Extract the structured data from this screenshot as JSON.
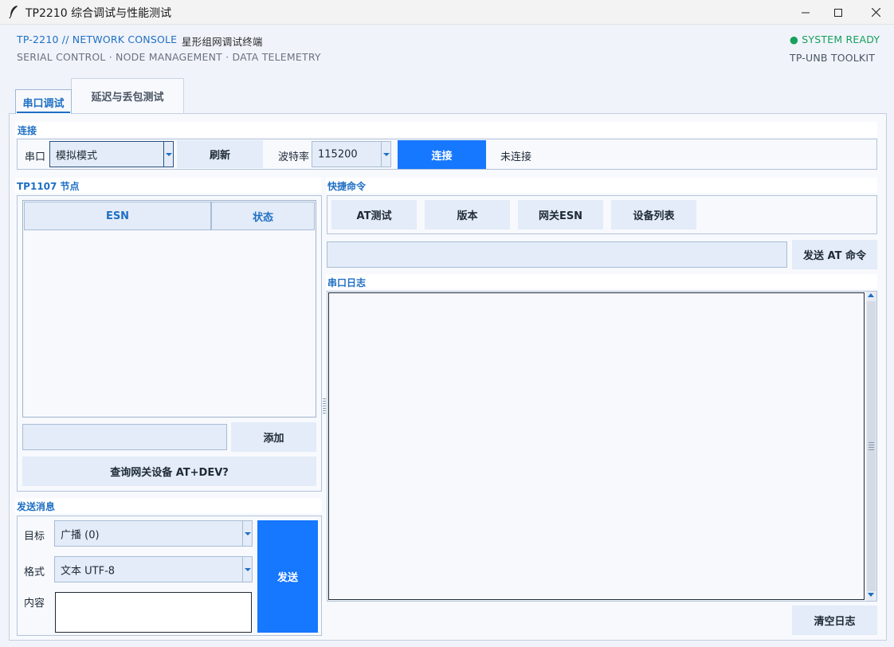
{
  "window": {
    "title": "TP2210 综合调试与性能测试",
    "controls": {
      "minimize_icon": "minimize-icon",
      "maximize_icon": "maximize-icon",
      "close_icon": "close-icon"
    }
  },
  "header": {
    "brand": "TP-2210 // NETWORK CONSOLE",
    "subtitle": "星形组网调试终端",
    "nav": "SERIAL CONTROL · NODE MANAGEMENT · DATA TELEMETRY",
    "status": "● SYSTEM READY",
    "toolkit": "TP-UNB TOOLKIT"
  },
  "tabs": [
    {
      "label": "串口调试",
      "active": true
    },
    {
      "label": "延迟与丢包测试",
      "active": false
    }
  ],
  "connection": {
    "section_label": "连接",
    "port_label": "串口",
    "port_value": "模拟模式",
    "refresh_button": "刷新",
    "baud_label": "波特率",
    "baud_value": "115200",
    "connect_button": "连接",
    "status_text": "未连接"
  },
  "nodes": {
    "section_label": "TP1107 节点",
    "columns": [
      "ESN",
      "状态"
    ],
    "rows": [],
    "esn_input_value": "",
    "add_button": "添加",
    "query_button": "查询网关设备 AT+DEV?"
  },
  "quick_commands": {
    "section_label": "快捷命令",
    "buttons": [
      "AT测试",
      "版本",
      "网关ESN",
      "设备列表"
    ],
    "at_input_value": "",
    "send_at_button": "发送 AT 命令"
  },
  "serial_log": {
    "section_label": "串口日志",
    "content": "",
    "clear_button": "清空日志"
  },
  "send_message": {
    "section_label": "发送消息",
    "target_label": "目标",
    "target_value": "广播 (0)",
    "format_label": "格式",
    "format_value": "文本 UTF-8",
    "content_label": "内容",
    "content_value": "",
    "send_button": "发送"
  },
  "colors": {
    "accent": "#1677ff",
    "section_label": "#1f6fc4",
    "status_ready": "#19a05c",
    "button_bg": "#e3ecf8",
    "panel_bg": "#f7f9fd"
  }
}
